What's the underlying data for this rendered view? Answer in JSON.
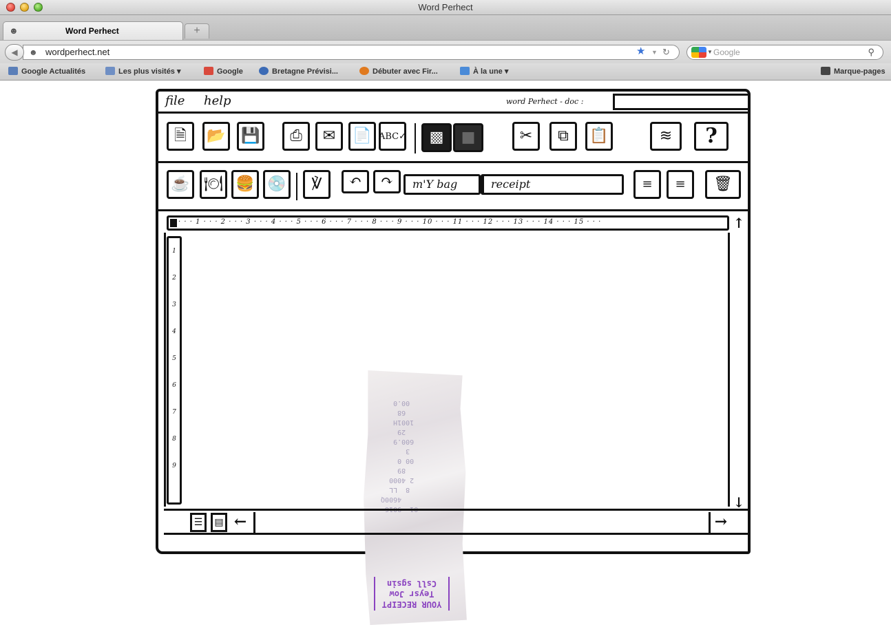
{
  "window": {
    "title": "Word Perhect"
  },
  "tab": {
    "label": "Word Perhect",
    "new_tab": "+"
  },
  "nav": {
    "url": "wordperhect.net",
    "search_placeholder": "Google"
  },
  "bookmarks": [
    {
      "label": "Google Actualités",
      "color": "#5b7fb8"
    },
    {
      "label": "Les plus visités ▾",
      "color": "#6f8fc4"
    },
    {
      "label": "Google",
      "color": "#d94a3d"
    },
    {
      "label": "Bretagne Prévisi...",
      "color": "#3c6bb5"
    },
    {
      "label": "Débuter avec Fir...",
      "color": "#e07a1f"
    },
    {
      "label": "À la une ▾",
      "color": "#4b8bd8"
    },
    {
      "label": "Marque-pages",
      "color": "#444444"
    }
  ],
  "app": {
    "menu": {
      "file": "file",
      "help": "help"
    },
    "doc_label": "word Perhect - doc :",
    "combo_bag": "m'Y bag",
    "combo_receipt": "receipt",
    "ruler": "· · · 1 · · · 2 · · · 3 · · · 4 · · · 5 · · · 6 · · · 7 · · · 8 · · · 9 · · · 10 · · · 11 · · · 12 · · · 13 · · · 14 · · · 15 · · ·",
    "vruler": [
      "1",
      "2",
      "3",
      "4",
      "5",
      "6",
      "7",
      "8",
      "9"
    ],
    "receipt": {
      "text": "01  9016\n    4600Q\n  8  LL\n 2 4000\n   89\n 00 0\n  3\n 600.9\n   29\n 1001H\n   68\n  00.0",
      "stamp": "YOUR RECEIPT\nTeysr Jow\nCsll sgsin"
    },
    "icons": {
      "new_doc": "new-document-icon",
      "open": "open-folder-icon",
      "save": "save-floppy-icon",
      "print": "print-icon",
      "mail": "mail-icon",
      "preview": "preview-icon",
      "spell": "spellcheck-icon",
      "paint": "paint-icon",
      "colorfill": "fill-icon",
      "cut": "cut-icon",
      "copy": "copy-icon",
      "paste": "paste-icon",
      "tornado": "tornado-icon",
      "help": "help-icon"
    }
  }
}
